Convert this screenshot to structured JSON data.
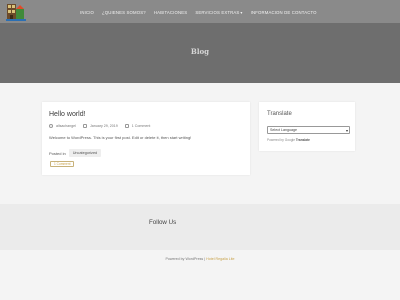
{
  "header": {
    "nav": [
      {
        "label": "INICIO",
        "has_dropdown": false
      },
      {
        "label": "¿QUIENES SOMOS?",
        "has_dropdown": false
      },
      {
        "label": "HABITACIONES",
        "has_dropdown": false
      },
      {
        "label": "SERVICIOS EXTRAS",
        "has_dropdown": true
      },
      {
        "label": "INFORMACION DE CONTACTO",
        "has_dropdown": false
      }
    ]
  },
  "hero": {
    "title": "Blog"
  },
  "post": {
    "title": "Hello world!",
    "author": "allsachangel",
    "date": "January 29, 2019",
    "comments": "1 Comment",
    "excerpt": "Welcome to WordPress. This is your first post. Edit or delete it, then start writing!",
    "posted_in_label": "Posted in",
    "category": "Uncategorized",
    "comment_chip": "1 Comment"
  },
  "widget": {
    "title": "Translate",
    "select_value": "Select Language",
    "powered_by": "Powered by",
    "powered_brand": "Google",
    "powered_product": "Translate"
  },
  "footer": {
    "follow_title": "Follow Us",
    "credit_prefix": "Powered by WordPress |",
    "credit_theme": "Hotel Regalia Lite"
  },
  "colors": {
    "topbar": "#8a8a8a",
    "hero": "#6e6e6e",
    "accent": "#c8a24a"
  }
}
